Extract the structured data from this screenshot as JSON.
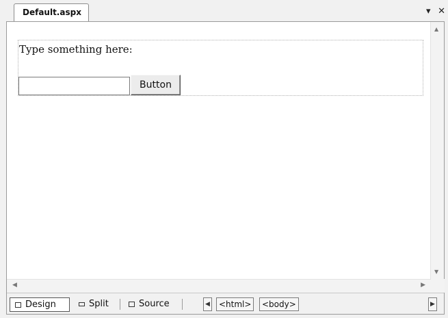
{
  "tab": {
    "title": "Default.aspx"
  },
  "window_controls": {
    "dropdown_glyph": "▾",
    "close_glyph": "✕"
  },
  "design": {
    "prompt": "Type something here:",
    "textbox_value": "",
    "button_label": "Button"
  },
  "scrollbars": {
    "up": "▲",
    "down": "▼",
    "left": "◀",
    "right": "▶"
  },
  "view_bar": {
    "design_label": "Design",
    "split_label": "Split",
    "source_label": "Source",
    "nav_left": "◀",
    "nav_right": "▶",
    "tags": [
      "<html>",
      "<body>"
    ]
  }
}
